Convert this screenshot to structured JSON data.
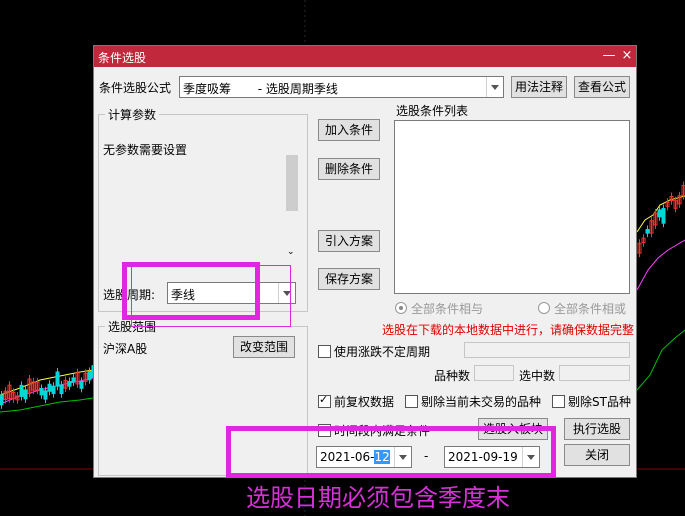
{
  "dialog": {
    "title": "条件选股",
    "formula_label": "条件选股公式",
    "formula_value": "季度吸筹       - 选股周期季线",
    "usage_notes_button": "用法注释",
    "view_formula_button": "查看公式",
    "params_group_label": "计算参数",
    "params_text": "无参数需要设置",
    "period_label": "选股周期:",
    "period_value": "季线",
    "range_group_label": "选股范围",
    "range_value": "沪深A股",
    "change_range_button": "改变范围",
    "conditions_list_label": "选股条件列表",
    "add_condition_button": "加入条件",
    "delete_condition_button": "删除条件",
    "import_plan_button": "引入方案",
    "save_plan_button": "保存方案",
    "all_and_label": "全部条件相与",
    "all_or_label": "全部条件相或",
    "warning": "选股在下载的本地数据中进行，请确保数据完整",
    "uncertain_period_label": "使用涨跌不定周期",
    "variety_count_label": "品种数",
    "selected_count_label": "选中数",
    "forward_adjust_label": "前复权数据",
    "exclude_untraded_label": "剔除当前未交易的品种",
    "exclude_st_label": "剔除ST品种",
    "time_segment_label": "时间段内满足条件",
    "to_board_button": "选股入板块",
    "execute_button": "执行选股",
    "start_date_prefix": "2021-06-",
    "start_date_day": "12",
    "date_separator": "-",
    "end_date": "2021-09-19",
    "close_button": "关闭",
    "close_icon": "×",
    "minimize_icon": "—"
  },
  "annotation": {
    "caption": "选股日期必须包含季度末"
  },
  "colors": {
    "title_bar": "#c2283b",
    "highlight": "#e026e0",
    "warning": "#e00000"
  }
}
